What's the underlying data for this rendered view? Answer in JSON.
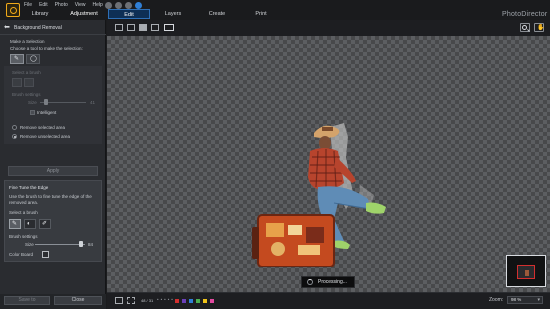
{
  "menu": [
    "File",
    "Edit",
    "Photo",
    "View",
    "Help"
  ],
  "left_tabs": [
    "Library",
    "Adjustment"
  ],
  "main_tabs": [
    {
      "label": "Edit",
      "active": true
    },
    {
      "label": "Layers",
      "active": false
    },
    {
      "label": "Create",
      "active": false
    },
    {
      "label": "Print",
      "active": false
    }
  ],
  "brand": "PhotoDirector",
  "panel": {
    "title": "Background Removal",
    "make_selection": "Make a Selection",
    "choose_tool": "Choose a tool to make the selection:",
    "select_brush_dim": "Select a brush",
    "brush_settings_dim": "Brush settings",
    "size_dim": "Size",
    "size_dim_value": "41",
    "intelligent": "Intelligent",
    "remove_selected": "Remove selected area",
    "remove_unselected": "Remove unselected area",
    "apply": "Apply",
    "fine_tune_title": "Fine Tune the Edge",
    "fine_tune_desc": "Use the brush to fine tune the edge of the removed area.",
    "select_brush": "Select a brush",
    "brush_settings": "Brush settings",
    "size": "Size",
    "size_value": "84",
    "color_board": "Color Board",
    "save_to": "Save to",
    "close": "Close"
  },
  "canvas": {
    "processing": "Processing..."
  },
  "bottom_bar": {
    "zoom_label": "Zoom:",
    "zoom_value": "98 %",
    "counter": "48 / 31",
    "swatches": [
      "#d32f2f",
      "#6a3fb8",
      "#2f7fd6",
      "#4caf50",
      "#f0c419",
      "#e24aa0"
    ]
  },
  "colors": {
    "accent": "#2f7fd6",
    "logo": "#f0a91a",
    "nav_frame": "#d32f2f"
  }
}
